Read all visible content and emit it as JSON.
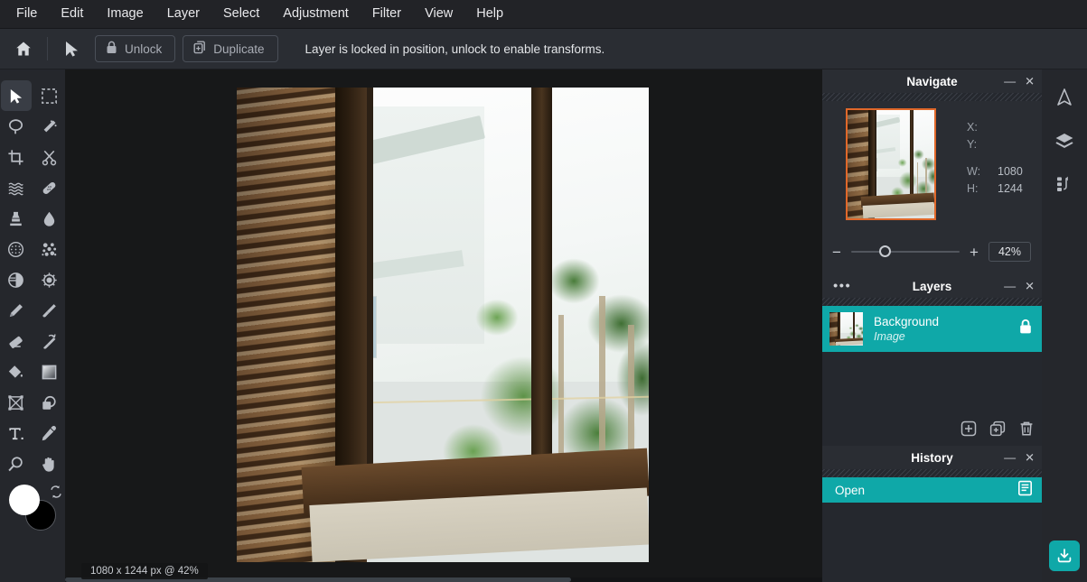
{
  "menubar": {
    "items": [
      {
        "label": "File"
      },
      {
        "label": "Edit"
      },
      {
        "label": "Image"
      },
      {
        "label": "Layer"
      },
      {
        "label": "Select"
      },
      {
        "label": "Adjustment"
      },
      {
        "label": "Filter"
      },
      {
        "label": "View"
      },
      {
        "label": "Help"
      }
    ]
  },
  "optionbar": {
    "home_icon": "home-icon",
    "tool_icon": "move-tool-icon",
    "unlock_label": "Unlock",
    "unlock_icon": "lock-icon",
    "duplicate_label": "Duplicate",
    "duplicate_icon": "duplicate-icon",
    "status": "Layer is locked in position, unlock to enable transforms."
  },
  "toolrail": {
    "tools": [
      {
        "name": "move-tool",
        "icon": "cursor-arrow-icon",
        "active": true
      },
      {
        "name": "marquee-select-tool",
        "icon": "dashed-rectangle-icon",
        "active": false
      },
      {
        "name": "lasso-select-tool",
        "icon": "lasso-icon",
        "active": false
      },
      {
        "name": "magic-wand-tool",
        "icon": "magic-wand-icon",
        "active": false
      },
      {
        "name": "crop-tool",
        "icon": "crop-icon",
        "active": false
      },
      {
        "name": "cut-tool",
        "icon": "scissors-icon",
        "active": false
      },
      {
        "name": "liquify-tool",
        "icon": "waves-icon",
        "active": false
      },
      {
        "name": "healing-tool",
        "icon": "bandage-icon",
        "active": false
      },
      {
        "name": "clone-stamp-tool",
        "icon": "stamp-icon",
        "active": false
      },
      {
        "name": "blur-tool",
        "icon": "water-drop-icon",
        "active": false
      },
      {
        "name": "halftone-tool",
        "icon": "dotted-globe-icon",
        "active": false
      },
      {
        "name": "scatter-tool",
        "icon": "bokeh-dots-icon",
        "active": false
      },
      {
        "name": "contrast-tool",
        "icon": "half-circle-icon",
        "active": false
      },
      {
        "name": "brightness-tool",
        "icon": "sun-gear-icon",
        "active": false
      },
      {
        "name": "pen-tool",
        "icon": "pen-icon",
        "active": false
      },
      {
        "name": "paintbrush-tool",
        "icon": "paintbrush-icon",
        "active": false
      },
      {
        "name": "eraser-tool",
        "icon": "eraser-icon",
        "active": false
      },
      {
        "name": "history-brush-tool",
        "icon": "brush-undo-icon",
        "active": false
      },
      {
        "name": "paint-bucket-tool",
        "icon": "paint-bucket-icon",
        "active": false
      },
      {
        "name": "gradient-tool",
        "icon": "gradient-square-icon",
        "active": false
      },
      {
        "name": "shape-frame-tool",
        "icon": "crossed-square-icon",
        "active": false
      },
      {
        "name": "shape-lock-tool",
        "icon": "padlock-shape-icon",
        "active": false
      },
      {
        "name": "text-tool",
        "icon": "text-t-icon",
        "active": false
      },
      {
        "name": "eyedropper-tool",
        "icon": "eyedropper-icon",
        "active": false
      },
      {
        "name": "zoom-tool",
        "icon": "magnifier-icon",
        "active": false
      },
      {
        "name": "hand-tool",
        "icon": "hand-icon",
        "active": false
      }
    ],
    "foreground_color": "#ffffff",
    "background_color": "#000000",
    "swap_icon": "swap-colors-icon"
  },
  "canvas": {
    "status_chip": "1080 x 1244 px @ 42%"
  },
  "panels": {
    "navigate": {
      "title": "Navigate",
      "minimize_icon": "minimize-icon",
      "close_icon": "close-icon",
      "fields": [
        {
          "key": "X:",
          "value": ""
        },
        {
          "key": "Y:",
          "value": ""
        },
        {
          "key": "W:",
          "value": "1080"
        },
        {
          "key": "H:",
          "value": "1244"
        }
      ],
      "zoom_out_label": "−",
      "zoom_in_label": "+",
      "zoom_value": "42%",
      "thumb_border_color": "#e0682a"
    },
    "layers": {
      "title": "Layers",
      "menu_icon": "more-options-icon",
      "minimize_icon": "minimize-icon",
      "close_icon": "close-icon",
      "rows": [
        {
          "name": "Background",
          "kind": "Image",
          "locked": true,
          "selected": true
        }
      ],
      "add_layer_icon": "add-layer-icon",
      "duplicate_layer_icon": "duplicate-layer-icon",
      "delete_layer_icon": "delete-layer-icon"
    },
    "history": {
      "title": "History",
      "minimize_icon": "minimize-icon",
      "close_icon": "close-icon",
      "entries": [
        {
          "label": "Open",
          "icon": "document-icon",
          "selected": true
        }
      ]
    }
  },
  "rightrail": {
    "items": [
      {
        "name": "navigate-panel-toggle",
        "icon": "navigate-arrow-icon"
      },
      {
        "name": "layers-panel-toggle",
        "icon": "layers-stack-icon"
      },
      {
        "name": "history-panel-toggle",
        "icon": "history-list-icon"
      }
    ],
    "export_icon": "export-download-icon"
  },
  "theme": {
    "accent": "#0fa8a8",
    "panel_bg": "#2a2d33",
    "rail_bg": "#25272c",
    "canvas_bg": "#171819",
    "menu_bg": "#222327",
    "highlight_orange": "#e0682a"
  }
}
